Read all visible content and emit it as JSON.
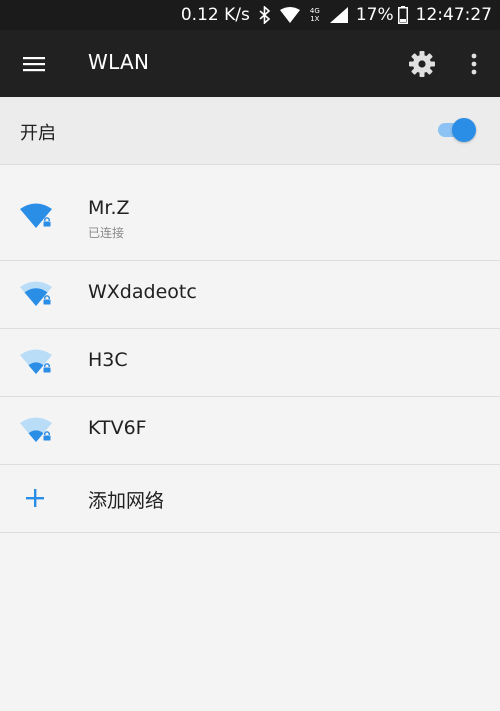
{
  "status_bar": {
    "speed": "0.12 K/s",
    "network_labels": "4G 1X",
    "battery": "17%",
    "time": "12:47:27"
  },
  "app_bar": {
    "title": "WLAN"
  },
  "wlan_toggle": {
    "label": "开启",
    "on": true
  },
  "networks": [
    {
      "ssid": "Mr.Z",
      "status": "已连接",
      "signal": "full",
      "secured": true
    },
    {
      "ssid": "WXdadeotc",
      "status": "",
      "signal": "medium",
      "secured": true
    },
    {
      "ssid": "H3C",
      "status": "",
      "signal": "low",
      "secured": true
    },
    {
      "ssid": "KTV6F",
      "status": "",
      "signal": "low",
      "secured": true
    }
  ],
  "add_network": {
    "label": "添加网络"
  },
  "colors": {
    "accent": "#2a8de6",
    "accent_light": "#8cc3f4",
    "app_bar": "#212121",
    "status_bar": "#1b1b1b",
    "background": "#f4f4f4"
  }
}
